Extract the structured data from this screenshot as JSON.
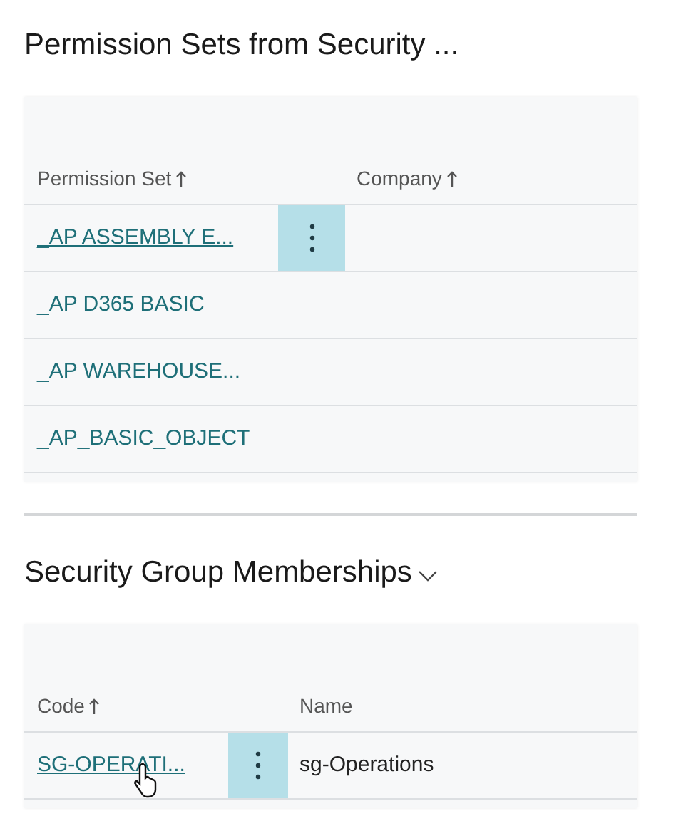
{
  "sections": [
    {
      "title": "Permission Sets from Security ...",
      "columns": [
        {
          "label": "Permission Set",
          "sorted": true
        },
        {
          "label": "Company",
          "sorted": true
        }
      ],
      "rows": [
        {
          "cells": [
            "_AP ASSEMBLY E...",
            ""
          ],
          "selected": true
        },
        {
          "cells": [
            "_AP D365 BASIC",
            ""
          ],
          "selected": false
        },
        {
          "cells": [
            "_AP WAREHOUSE...",
            ""
          ],
          "selected": false
        },
        {
          "cells": [
            "_AP_BASIC_OBJECT",
            ""
          ],
          "selected": false
        }
      ]
    },
    {
      "title": "Security Group Memberships",
      "expanded": true,
      "columns": [
        {
          "label": "Code",
          "sorted": true
        },
        {
          "label": "Name",
          "sorted": false
        }
      ],
      "rows": [
        {
          "cells": [
            "SG-OPERATI...",
            "sg-Operations"
          ],
          "selected": true,
          "pointer": true
        }
      ]
    }
  ]
}
